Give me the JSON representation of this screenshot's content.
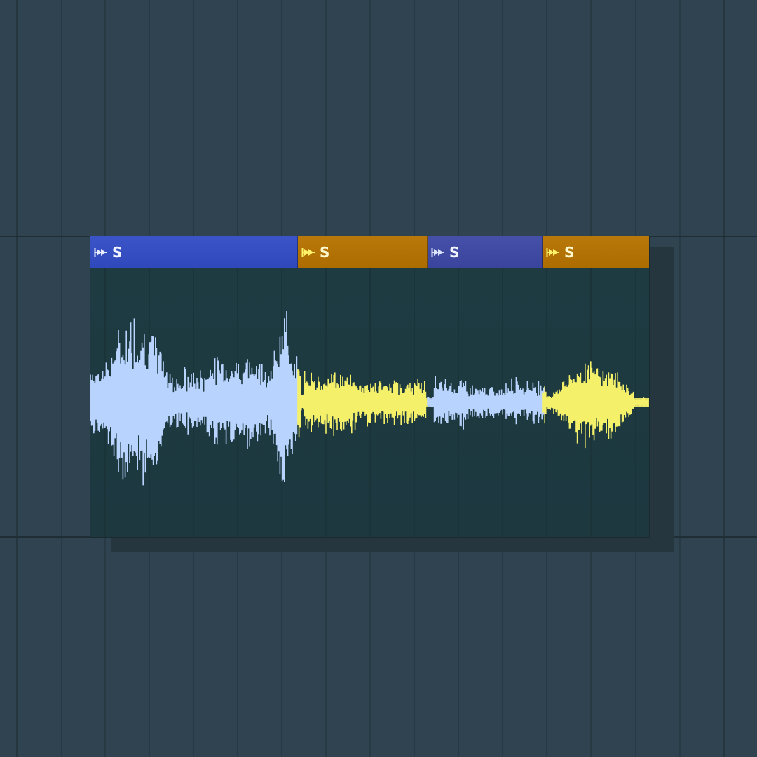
{
  "colors": {
    "background": "#2f4450",
    "grid_line": "#26363f",
    "clip_body": "#1f3a41",
    "blue_header": "#3b55c8",
    "blue_header_dim": "#4650a8",
    "orange_header": "#b8780a",
    "blue_wave": "#b9d3ff",
    "yellow_wave": "#f5f06a"
  },
  "clip": {
    "slices": [
      {
        "label": "S",
        "color": "blue",
        "icon": "slice-marker-icon"
      },
      {
        "label": "S",
        "color": "orange",
        "icon": "slice-marker-icon"
      },
      {
        "label": "S",
        "color": "blue-dim",
        "icon": "slice-marker-icon"
      },
      {
        "label": "S",
        "color": "orange",
        "icon": "slice-marker-icon"
      }
    ]
  }
}
